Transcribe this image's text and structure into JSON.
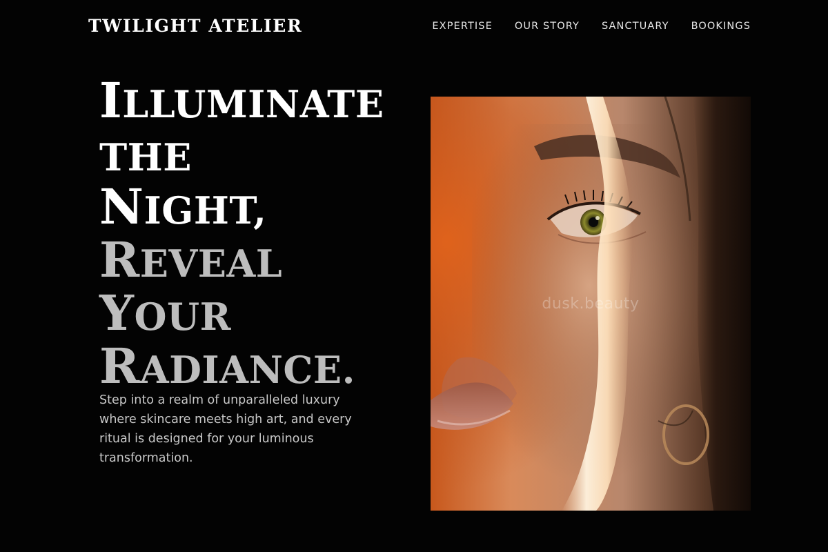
{
  "brand": {
    "name": "TWILIGHT ATELIER"
  },
  "nav": {
    "items": [
      {
        "label": "EXPERTISE"
      },
      {
        "label": "OUR STORY"
      },
      {
        "label": "SANCTUARY"
      },
      {
        "label": "BOOKINGS"
      }
    ]
  },
  "hero": {
    "title_lines": [
      {
        "cap": "I",
        "rest": "LLUMINATE"
      },
      {
        "cap": "",
        "rest": "THE"
      },
      {
        "cap": "N",
        "rest": "IGHT,"
      },
      {
        "cap": "R",
        "rest": "EVEAL"
      },
      {
        "cap": "Y",
        "rest": "OUR"
      },
      {
        "cap": "R",
        "rest": "ADIANCE."
      }
    ],
    "description": "Step into a realm of unparalleled luxury where skincare meets high art, and every ritual is designed for your luminous transformation.",
    "image": {
      "watermark": "dusk.beauty"
    }
  },
  "colors": {
    "background": "#030303",
    "headline_primary": "#ffffff",
    "headline_secondary": "#bdbdbd",
    "body_text": "#c9c9c9"
  }
}
